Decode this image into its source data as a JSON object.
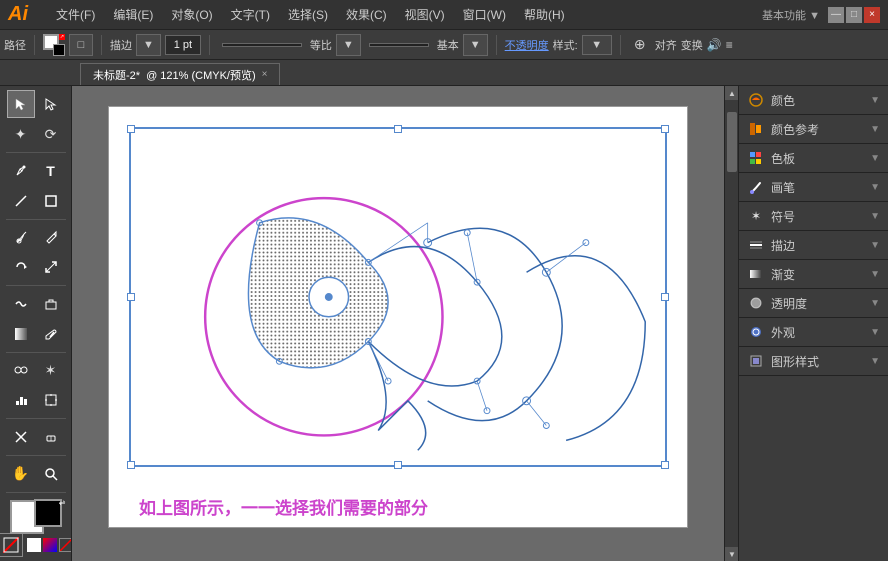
{
  "app": {
    "logo": "Ai",
    "workspace_label": "基本功能 ▼"
  },
  "titlebar": {
    "menu": [
      "文件(F)",
      "编辑(E)",
      "对象(O)",
      "文字(T)",
      "选择(S)",
      "效果(C)",
      "视图(V)",
      "窗口(W)",
      "帮助(H)"
    ],
    "win_btns": [
      "—",
      "□",
      "×"
    ]
  },
  "toolbar": {
    "path_label": "路径",
    "stroke_label": "描边",
    "stroke_width": "1 pt",
    "stroke_style": "等比",
    "stroke_preset": "基本",
    "opacity_label": "不透明度",
    "style_label": "样式:",
    "align_label": "对齐",
    "transform_label": "变换"
  },
  "tab": {
    "title": "未标题-2*",
    "info": "@ 121% (CMYK/预览)",
    "close": "×"
  },
  "tools": [
    {
      "name": "select",
      "icon": "↖",
      "title": "选择工具"
    },
    {
      "name": "direct-select",
      "icon": "↗",
      "title": "直接选择"
    },
    {
      "name": "magic-wand",
      "icon": "✦",
      "title": "魔棒"
    },
    {
      "name": "lasso",
      "icon": "⟳",
      "title": "套索"
    },
    {
      "name": "pen",
      "icon": "✒",
      "title": "钢笔"
    },
    {
      "name": "type",
      "icon": "T",
      "title": "文字"
    },
    {
      "name": "line",
      "icon": "╲",
      "title": "直线"
    },
    {
      "name": "rect",
      "icon": "□",
      "title": "矩形"
    },
    {
      "name": "paintbrush",
      "icon": "🖌",
      "title": "画笔"
    },
    {
      "name": "pencil",
      "icon": "✏",
      "title": "铅笔"
    },
    {
      "name": "rotate",
      "icon": "↻",
      "title": "旋转"
    },
    {
      "name": "scale",
      "icon": "⤡",
      "title": "缩放"
    },
    {
      "name": "warp",
      "icon": "≋",
      "title": "变形"
    },
    {
      "name": "gradient",
      "icon": "▣",
      "title": "渐变"
    },
    {
      "name": "eyedropper",
      "icon": "💉",
      "title": "吸管"
    },
    {
      "name": "blend",
      "icon": "∞",
      "title": "混合"
    },
    {
      "name": "symbol",
      "icon": "❋",
      "title": "符号"
    },
    {
      "name": "column-chart",
      "icon": "▦",
      "title": "柱形图"
    },
    {
      "name": "artboard",
      "icon": "⊞",
      "title": "画板"
    },
    {
      "name": "slice",
      "icon": "✂",
      "title": "切片"
    },
    {
      "name": "hand",
      "icon": "✋",
      "title": "抓手"
    },
    {
      "name": "zoom",
      "icon": "🔍",
      "title": "缩放"
    }
  ],
  "right_panel": {
    "sections": [
      {
        "icon": "color",
        "label": "颜色",
        "expand": false
      },
      {
        "icon": "color-ref",
        "label": "颜色参考",
        "expand": false
      },
      {
        "icon": "swatches",
        "label": "色板",
        "expand": false
      },
      {
        "icon": "brush",
        "label": "画笔",
        "expand": false
      },
      {
        "icon": "symbol",
        "label": "符号",
        "expand": false
      },
      {
        "icon": "stroke",
        "label": "描边",
        "expand": false
      },
      {
        "icon": "gradient",
        "label": "渐变",
        "expand": false
      },
      {
        "icon": "opacity",
        "label": "透明度",
        "expand": false
      },
      {
        "icon": "appearance",
        "label": "外观",
        "expand": false
      },
      {
        "icon": "graphic-style",
        "label": "图形样式",
        "expand": false
      }
    ]
  },
  "canvas": {
    "caption": "如上图所示，一一选择我们需要的部分"
  }
}
